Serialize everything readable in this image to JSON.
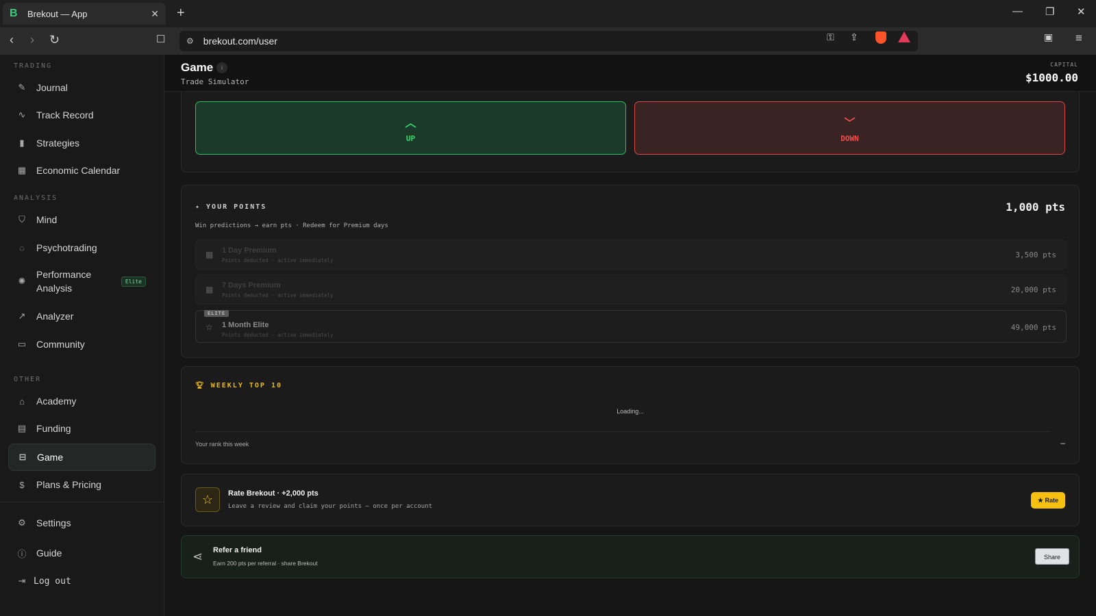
{
  "browser": {
    "tab_title": "Brekout — App",
    "favicon": "B",
    "url": "brekout.com/user"
  },
  "sidebar": {
    "sections": {
      "trading": "TRADING",
      "analysis": "ANALYSIS",
      "other": "OTHER"
    },
    "items": [
      {
        "label": "Journal",
        "icon": "pencil-icon"
      },
      {
        "label": "Track Record",
        "icon": "activity-icon"
      },
      {
        "label": "Strategies",
        "icon": "bars-icon"
      },
      {
        "label": "Economic Calendar",
        "icon": "calendar-icon"
      },
      {
        "label": "Mind",
        "icon": "shield-icon"
      },
      {
        "label": "Psychotrading",
        "icon": "bulb-icon"
      },
      {
        "label": "Performance Analysis",
        "icon": "sun-icon",
        "badge": "Elite"
      },
      {
        "label": "Analyzer",
        "icon": "trend-icon"
      },
      {
        "label": "Community",
        "icon": "chat-icon"
      },
      {
        "label": "Academy",
        "icon": "cap-icon"
      },
      {
        "label": "Funding",
        "icon": "briefcase-icon"
      },
      {
        "label": "Game",
        "icon": "gamepad-icon",
        "active": true
      },
      {
        "label": "Plans & Pricing",
        "icon": "dollar-icon"
      }
    ],
    "bottom": {
      "settings": "Settings",
      "guide": "Guide",
      "logout": "Log out"
    }
  },
  "header": {
    "title": "Game",
    "subtitle": "Trade Simulator",
    "capital_label": "CAPITAL",
    "capital_value": "$1000.00"
  },
  "prediction": {
    "up_label": "UP",
    "down_label": "DOWN"
  },
  "points": {
    "title": "✦ YOUR POINTS",
    "value": "1,000 pts",
    "subtitle": "Win predictions → earn pts · Redeem for Premium days",
    "rewards": [
      {
        "title": "1 Day Premium",
        "desc": "Points deducted · active immediately",
        "cost": "3,500 pts"
      },
      {
        "title": "7 Days Premium",
        "desc": "Points deducted · active immediately",
        "cost": "20,000 pts"
      },
      {
        "title": "1 Month Elite",
        "desc": "Points deducted · active immediately",
        "cost": "49,000 pts",
        "tag": "ELITE"
      }
    ]
  },
  "weekly": {
    "title": "WEEKLY TOP 10",
    "loading": "Loading...",
    "rank_label": "Your rank this week",
    "rank_value": "–"
  },
  "rate": {
    "title": "Rate Brekout · +2,000 pts",
    "subtitle": "Leave a review and claim your points — once per account",
    "button": "★ Rate"
  },
  "refer": {
    "title": "Refer a friend",
    "subtitle": "Earn 200 pts per referral · share Brekout",
    "button": "Share"
  },
  "colors": {
    "up": "#35d56f",
    "down": "#f04f4f",
    "accent_gold": "#f5c010"
  }
}
